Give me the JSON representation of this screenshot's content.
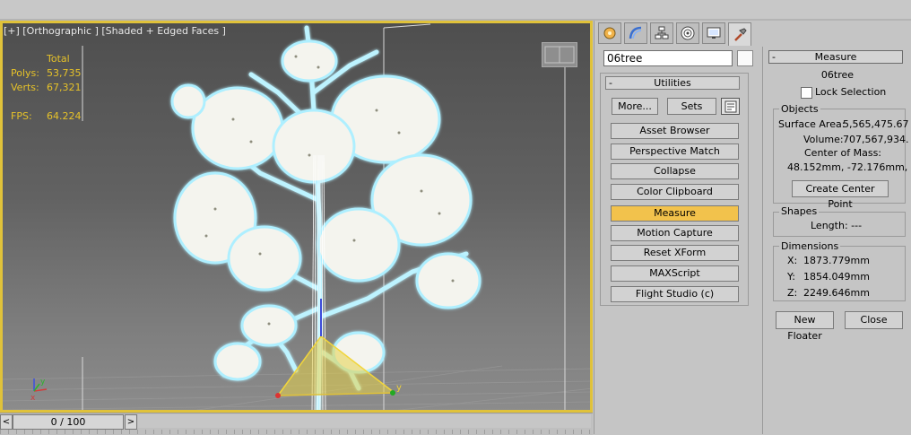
{
  "viewport": {
    "label": "[+] [Orthographic ] [Shaded + Edged Faces ]",
    "stats": {
      "header": "Total",
      "polys_label": "Polys:",
      "polys_value": "53,735",
      "verts_label": "Verts:",
      "verts_value": "67,321",
      "fps_label": "FPS:",
      "fps_value": "64.224"
    },
    "axis": {
      "x": "x",
      "y": "y"
    }
  },
  "timeslider": {
    "prev": "<",
    "label": "0 / 100",
    "next": ">"
  },
  "command_panel": {
    "tabs": [
      "create-tab",
      "modify-tab",
      "hierarchy-tab",
      "motion-tab",
      "display-tab",
      "utilities-tab"
    ],
    "object_name": "06tree",
    "utilities": {
      "collapse": "-",
      "title": "Utilities",
      "more": "More...",
      "sets": "Sets",
      "items": [
        "Asset Browser",
        "Perspective Match",
        "Collapse",
        "Color Clipboard",
        "Measure",
        "Motion Capture",
        "Reset XForm",
        "MAXScript",
        "Flight Studio (c)"
      ],
      "active": "Measure"
    }
  },
  "measure": {
    "collapse": "-",
    "title": "Measure",
    "object_name": "06tree",
    "lock_selection": "Lock Selection",
    "objects": {
      "title": "Objects",
      "surface_area_label": "Surface Area:",
      "surface_area": "5,565,475.67",
      "volume_label": "Volume:",
      "volume": "707,567,934.",
      "center_label": "Center of Mass:",
      "center": "48.152mm, -72.176mm,",
      "create_center": "Create Center Point"
    },
    "shapes": {
      "title": "Shapes",
      "length": "Length: ---"
    },
    "dimensions": {
      "title": "Dimensions",
      "x_label": "X:",
      "x": "1873.779mm",
      "y_label": "Y:",
      "y": "1854.049mm",
      "z_label": "Z:",
      "z": "2249.646mm"
    },
    "new_floater": "New Floater",
    "close": "Close"
  },
  "colors": {
    "selection": "#e0c23a",
    "active_button": "#f2c24c",
    "stats_text": "#e6c229"
  }
}
